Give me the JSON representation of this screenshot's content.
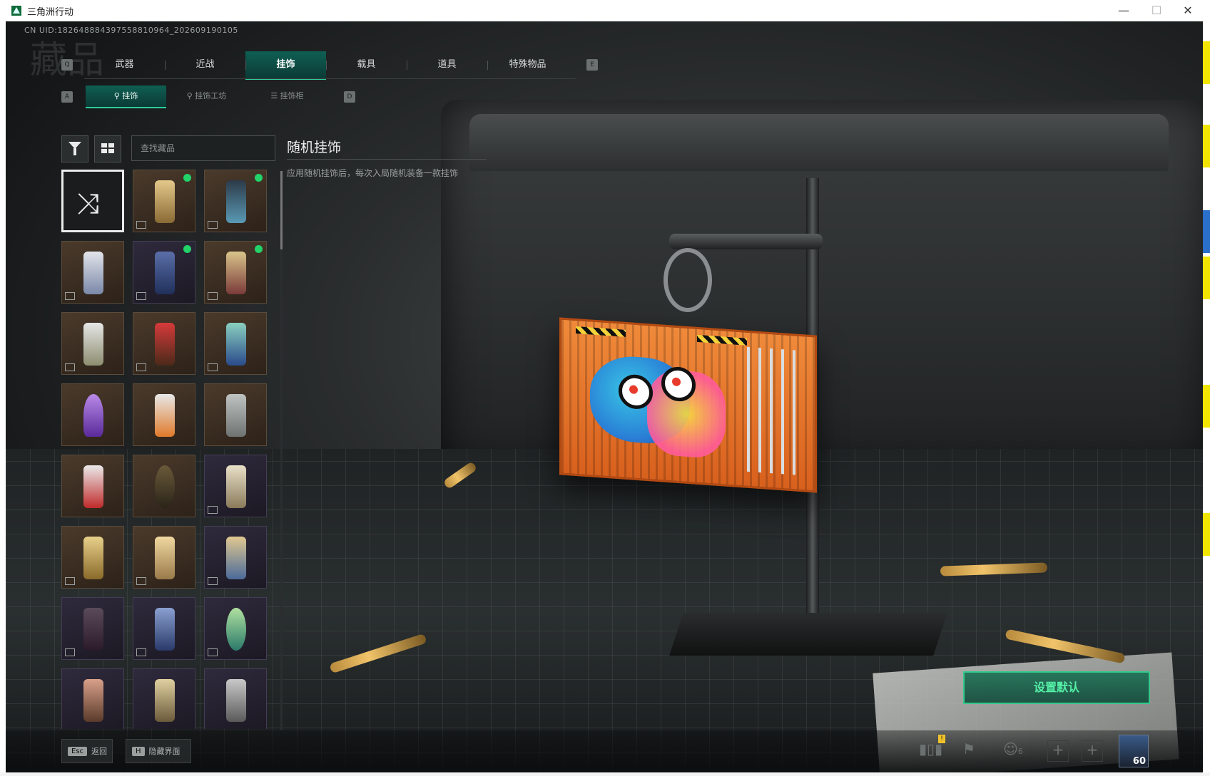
{
  "window": {
    "title": "三角洲行动",
    "minimize": "—",
    "maximize": "☐",
    "close": "✕"
  },
  "uid_text": "CN UID:18264888439755881096​4_202609190105",
  "bg_title": "藏品",
  "tabs": {
    "key_left": "Q",
    "key_right": "E",
    "items": [
      "武器",
      "近战",
      "挂饰",
      "载具",
      "道具",
      "特殊物品"
    ],
    "active_index": 2
  },
  "subtabs": {
    "key_left": "A",
    "key_right": "D",
    "items": [
      "挂饰",
      "挂饰工坊",
      "挂饰柜"
    ],
    "active_index": 0
  },
  "search": {
    "placeholder": "查找藏品"
  },
  "detail": {
    "title": "随机挂饰",
    "description": "应用随机挂饰后，每次入局随机装备一款挂饰"
  },
  "set_default_label": "设置默认",
  "bottom": {
    "back_key": "Esc",
    "back_label": "返回",
    "hide_key": "H",
    "hide_label": "隐藏界面",
    "warn": "!",
    "friends_count": "6",
    "level": "60"
  },
  "colors": {
    "accent": "#2ecc9b",
    "active_tab": "#0f5f53",
    "owned_dot": "#22d36a",
    "set_default_text": "#55f0a8"
  }
}
